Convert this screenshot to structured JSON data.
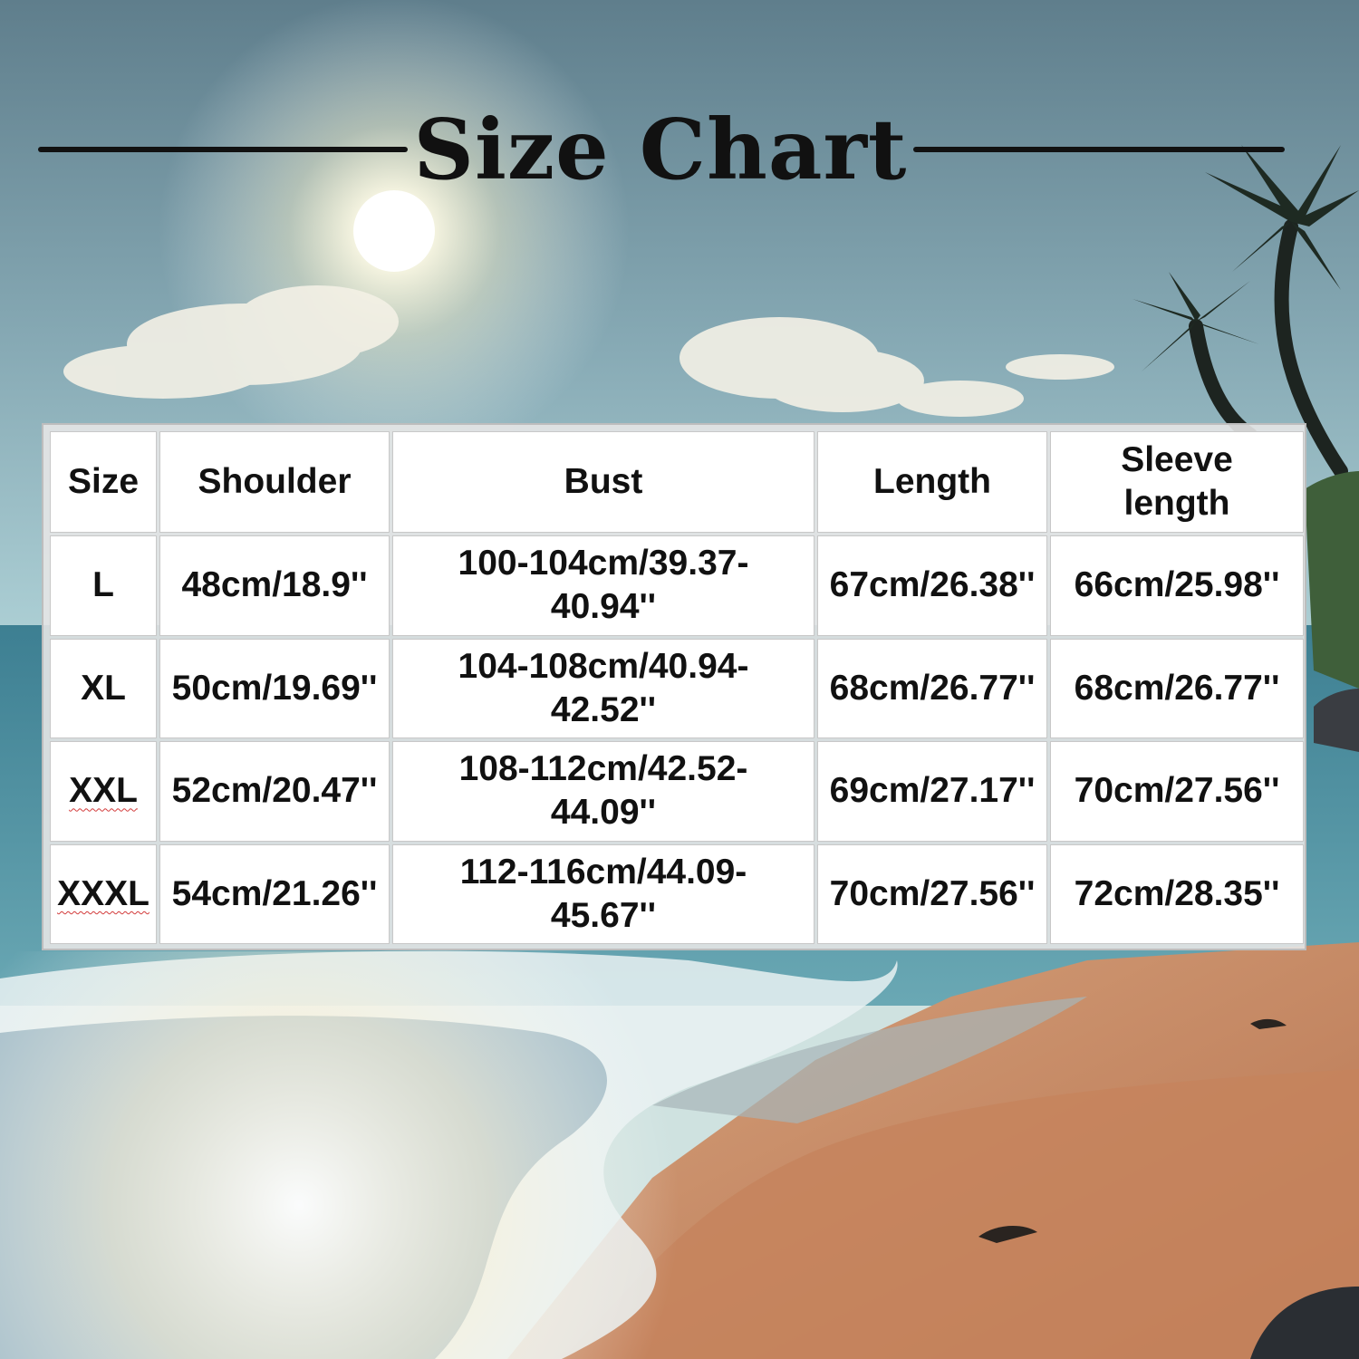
{
  "title": "Size Chart",
  "table": {
    "headers": [
      "Size",
      "Shoulder",
      "Bust",
      "Length",
      "Sleeve length"
    ],
    "rows": [
      [
        "L",
        "48cm/18.9''",
        "100-104cm/39.37-40.94''",
        "67cm/26.38''",
        "66cm/25.98''"
      ],
      [
        "XL",
        "50cm/19.69''",
        "104-108cm/40.94-42.52''",
        "68cm/26.77''",
        "68cm/26.77''"
      ],
      [
        "XXL",
        "52cm/20.47''",
        "108-112cm/42.52-44.09''",
        "69cm/27.17''",
        "70cm/27.56''"
      ],
      [
        "XXXL",
        "54cm/21.26''",
        "112-116cm/44.09-45.67''",
        "70cm/27.56''",
        "72cm/28.35''"
      ]
    ]
  },
  "colors": {
    "sky_top": "#5d7e8e",
    "sky_mid": "#8fb7c3",
    "sea": "#4d8fa0",
    "sand": "#c98c64",
    "text": "#111111"
  }
}
